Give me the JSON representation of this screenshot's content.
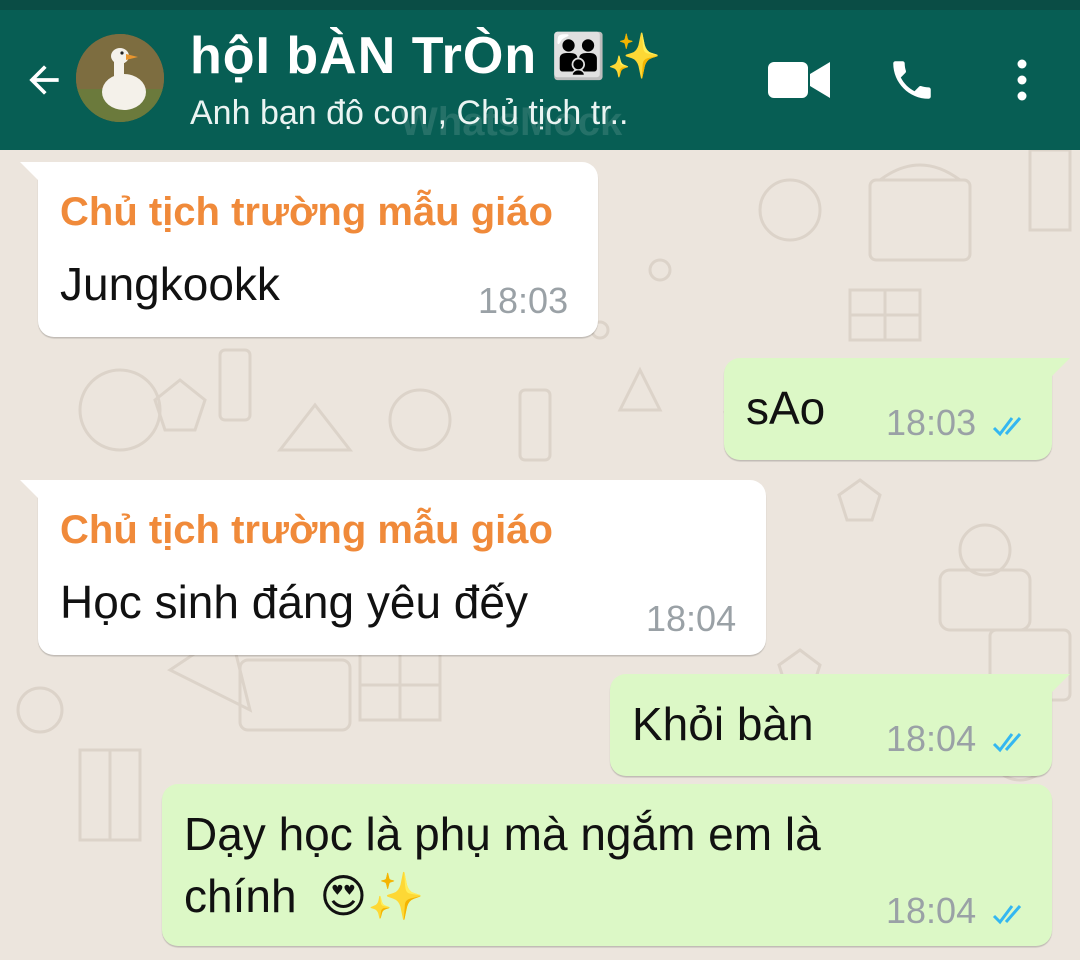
{
  "header": {
    "title": "hộI bÀN TrÒn",
    "title_emojis": "👨‍👨‍👦✨",
    "subtitle": "Anh bạn đô con , Chủ tịch tr..",
    "watermark": "WhatsMock",
    "icons": [
      "back-arrow-icon",
      "video-call-icon",
      "phone-icon",
      "more-vert-icon"
    ],
    "bar_color": "#075e54"
  },
  "messages": [
    {
      "direction": "incoming",
      "sender": "Chủ tịch trường mẫu giáo",
      "text": "Jungkookk",
      "time": "18:03"
    },
    {
      "direction": "outgoing",
      "text": "sAo",
      "time": "18:03",
      "status": "read"
    },
    {
      "direction": "incoming",
      "sender": "Chủ tịch trường mẫu giáo",
      "text": "Học sinh đáng yêu đếy",
      "time": "18:04"
    },
    {
      "direction": "outgoing",
      "text": "Khỏi bàn",
      "time": "18:04",
      "status": "read"
    },
    {
      "direction": "outgoing",
      "text_line1": "Dạy học là phụ mà ngắm em là",
      "text_line2": "chính",
      "text_emojis": "😍✨",
      "time": "18:04",
      "status": "read"
    }
  ],
  "colors": {
    "incoming_bubble": "#ffffff",
    "outgoing_bubble": "#dcf8c6",
    "sender_name": "#f08a3a",
    "read_ticks": "#34b7f1",
    "chat_background": "#ece5dd"
  }
}
